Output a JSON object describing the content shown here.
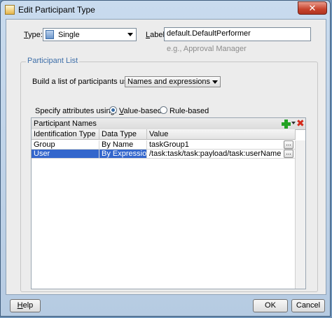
{
  "window": {
    "title": "Edit Participant Type",
    "close_glyph": "✕"
  },
  "type_field": {
    "label_prefix": "",
    "label_mnemonic": "T",
    "label_rest": "ype:",
    "value": "Single",
    "icon": "participant-icon"
  },
  "label_field": {
    "label_mnemonic": "L",
    "label_rest": "abel:",
    "value": "default.DefaultPerformer",
    "hint": "e.g., Approval Manager"
  },
  "participant_list": {
    "title": "Participant List",
    "build_label": "Build a list of participants using:",
    "build_value": "Names and expressions",
    "specify_label": "Specify attributes using:",
    "value_based_label_mnemonic": "V",
    "value_based_label_rest": "alue-based",
    "rule_based_label": "Rule-based",
    "selected": "value-based"
  },
  "names_table": {
    "title": "Participant Names",
    "add_icon": "add-icon",
    "delete_icon": "delete-icon",
    "columns": [
      "Identification Type",
      "Data Type",
      "Value"
    ],
    "rows": [
      {
        "id_type": "Group",
        "data_type": "By Name",
        "value": "taskGroup1",
        "selected": false
      },
      {
        "id_type": "User",
        "data_type": "By Expression",
        "value": "/task:task/task:payload/task:userName",
        "selected": true
      }
    ],
    "ellipsis": "..."
  },
  "footer": {
    "help_mnemonic": "H",
    "help_rest": "elp",
    "ok_label": "OK",
    "cancel_label": "Cancel"
  },
  "colors": {
    "accent": "#3d6ea8",
    "selection": "#3366cc",
    "add_green": "#23a223",
    "delete_red": "#d42a1a",
    "close_red": "#c7432d"
  }
}
